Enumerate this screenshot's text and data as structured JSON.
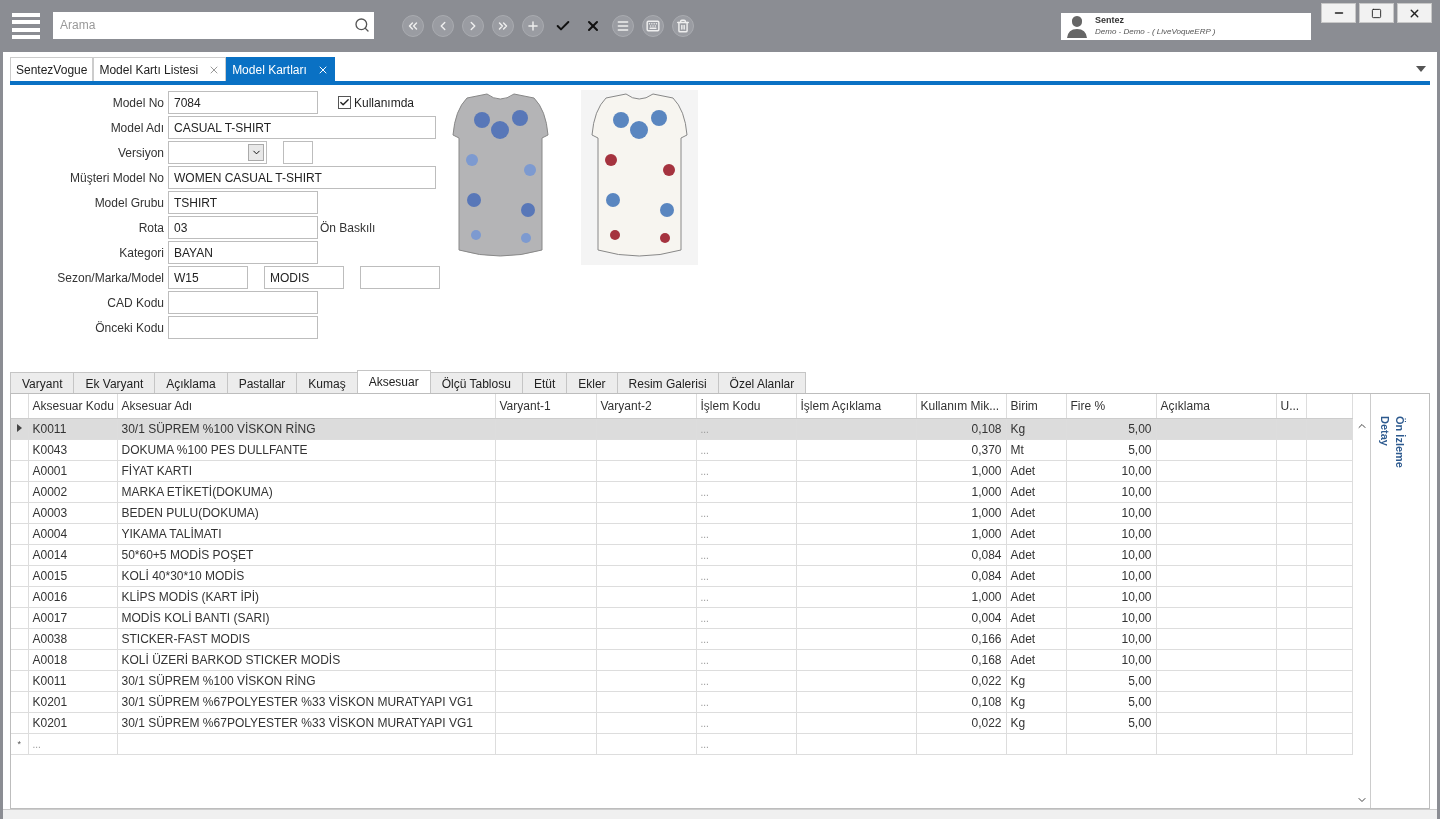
{
  "topbar": {
    "search": {
      "placeholder": "Arama"
    },
    "tools": [
      {
        "active": false
      },
      {
        "active": false
      },
      {
        "active": false
      },
      {
        "active": false
      },
      {
        "active": false
      },
      {
        "active": true
      },
      {
        "active": true
      },
      {
        "active": false
      },
      {
        "active": false
      },
      {
        "active": false
      }
    ],
    "user": {
      "name": "Sentez",
      "detail": "Demo - Demo - ( LiveVoqueERP )"
    }
  },
  "doc_tabs": [
    {
      "label": "SentezVogue",
      "closable": false,
      "selected": false
    },
    {
      "label": "Model Kartı Listesi",
      "closable": true,
      "selected": false
    },
    {
      "label": "Model Kartları",
      "closable": true,
      "selected": true
    }
  ],
  "form": [
    {
      "label": "Model No",
      "fields": [
        {
          "kind": "text",
          "value": "7084"
        },
        {
          "kind": "checkbox",
          "label": "Kullanımda",
          "checked": true
        }
      ]
    },
    {
      "label": "Model Adı",
      "fields": [
        {
          "kind": "text",
          "value": "CASUAL T-SHIRT"
        }
      ]
    },
    {
      "label": "Versiyon",
      "fields": [
        {
          "kind": "dropdown"
        },
        {
          "kind": "text"
        }
      ]
    },
    {
      "label": "Müşteri Model No",
      "fields": [
        {
          "kind": "text",
          "value": "WOMEN CASUAL T-SHIRT"
        }
      ]
    },
    {
      "label": "Model Grubu",
      "fields": [
        {
          "kind": "text",
          "value": "TSHIRT"
        }
      ]
    },
    {
      "label": "Rota",
      "fields": [
        {
          "kind": "text",
          "value": "03"
        },
        {
          "kind": "note",
          "text": "Ön Baskılı"
        }
      ]
    },
    {
      "label": "Kategori",
      "fields": [
        {
          "kind": "text",
          "value": "BAYAN"
        }
      ]
    },
    {
      "label": "Sezon/Marka/Model",
      "fields": [
        {
          "kind": "text",
          "value": "W15"
        },
        {
          "kind": "text",
          "value": "MODIS"
        },
        {
          "kind": "text"
        }
      ]
    },
    {
      "label": "CAD Kodu",
      "fields": [
        {
          "kind": "text"
        }
      ]
    },
    {
      "label": "Önceki Kodu",
      "fields": [
        {
          "kind": "text"
        }
      ]
    }
  ],
  "images": [
    {
      "kind": "picture"
    },
    {
      "kind": "picture"
    }
  ],
  "tabs": [
    {
      "label": "Varyant",
      "selected": false
    },
    {
      "label": "Ek Varyant",
      "selected": false
    },
    {
      "label": "Açıklama",
      "selected": false
    },
    {
      "label": "Pastallar",
      "selected": false
    },
    {
      "label": "Kumaş",
      "selected": false
    },
    {
      "label": "Aksesuar",
      "selected": true
    },
    {
      "label": "Ölçü Tablosu",
      "selected": false
    },
    {
      "label": "Etüt",
      "selected": false
    },
    {
      "label": "Ekler",
      "selected": false
    },
    {
      "label": "Resim Galerisi",
      "selected": false
    },
    {
      "label": "Özel Alanlar",
      "selected": false
    }
  ],
  "table": {
    "columns": [
      {
        "label": "Aksesuar Kodu",
        "kind": "text"
      },
      {
        "label": "Aksesuar Adı",
        "kind": "text"
      },
      {
        "label": "Varyant-1",
        "kind": "text"
      },
      {
        "label": "Varyant-2",
        "kind": "text"
      },
      {
        "label": "İşlem Kodu",
        "kind": "text"
      },
      {
        "label": "İşlem Açıklama",
        "kind": "text"
      },
      {
        "label": "Kullanım Mik...",
        "kind": "number"
      },
      {
        "label": "Birim",
        "kind": "text"
      },
      {
        "label": "Fire %",
        "kind": "number"
      },
      {
        "label": "Açıklama",
        "kind": "text"
      },
      {
        "label": "U...",
        "kind": "text"
      }
    ],
    "rows": [
      {
        "selected": true,
        "code": "K0011",
        "name": "30/1 SÜPREM %100 VİSKON RİNG",
        "op": "...",
        "qty": "0,108",
        "unit": "Kg",
        "waste": "5,00"
      },
      {
        "selected": false,
        "code": "K0043",
        "name": "DOKUMA %100 PES DULLFANTE",
        "op": "...",
        "qty": "0,370",
        "unit": "Mt",
        "waste": "5,00"
      },
      {
        "selected": false,
        "code": "A0001",
        "name": "FİYAT KARTI",
        "op": "...",
        "qty": "1,000",
        "unit": "Adet",
        "waste": "10,00"
      },
      {
        "selected": false,
        "code": "A0002",
        "name": "MARKA ETİKETİ(DOKUMA)",
        "op": "...",
        "qty": "1,000",
        "unit": "Adet",
        "waste": "10,00"
      },
      {
        "selected": false,
        "code": "A0003",
        "name": "BEDEN PULU(DOKUMA)",
        "op": "...",
        "qty": "1,000",
        "unit": "Adet",
        "waste": "10,00"
      },
      {
        "selected": false,
        "code": "A0004",
        "name": "YIKAMA TALİMATI",
        "op": "...",
        "qty": "1,000",
        "unit": "Adet",
        "waste": "10,00"
      },
      {
        "selected": false,
        "code": "A0014",
        "name": "50*60+5 MODİS POŞET",
        "op": "...",
        "qty": "0,084",
        "unit": "Adet",
        "waste": "10,00"
      },
      {
        "selected": false,
        "code": "A0015",
        "name": "KOLİ 40*30*10 MODİS",
        "op": "...",
        "qty": "0,084",
        "unit": "Adet",
        "waste": "10,00"
      },
      {
        "selected": false,
        "code": "A0016",
        "name": "KLİPS MODİS (KART İPİ)",
        "op": "...",
        "qty": "1,000",
        "unit": "Adet",
        "waste": "10,00"
      },
      {
        "selected": false,
        "code": "A0017",
        "name": "MODİS KOLİ BANTI (SARI)",
        "op": "...",
        "qty": "0,004",
        "unit": "Adet",
        "waste": "10,00"
      },
      {
        "selected": false,
        "code": "A0038",
        "name": "STICKER-FAST MODIS",
        "op": "...",
        "qty": "0,166",
        "unit": "Adet",
        "waste": "10,00"
      },
      {
        "selected": false,
        "code": "A0018",
        "name": "KOLİ ÜZERİ BARKOD STICKER MODİS",
        "op": "...",
        "qty": "0,168",
        "unit": "Adet",
        "waste": "10,00"
      },
      {
        "selected": false,
        "code": "K0011",
        "name": "30/1 SÜPREM %100 VİSKON RİNG",
        "op": "...",
        "qty": "0,022",
        "unit": "Kg",
        "waste": "5,00"
      },
      {
        "selected": false,
        "code": "K0201",
        "name": "30/1 SÜPREM %67POLYESTER %33 VİSKON MURATYAPI VG1",
        "op": "...",
        "qty": "0,108",
        "unit": "Kg",
        "waste": "5,00"
      },
      {
        "selected": false,
        "code": "K0201",
        "name": "30/1 SÜPREM %67POLYESTER %33 VİSKON MURATYAPI VG1",
        "op": "...",
        "qty": "0,022",
        "unit": "Kg",
        "waste": "5,00"
      }
    ],
    "new_row": {
      "marker": "*",
      "code": "...",
      "op": "..."
    }
  },
  "side_panel": [
    "Detay",
    "Ön İzleme"
  ]
}
